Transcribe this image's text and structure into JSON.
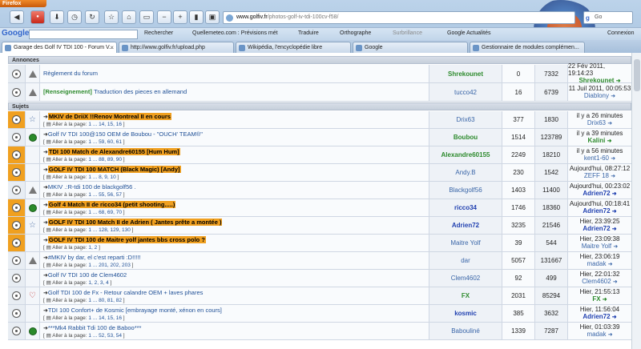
{
  "window": {
    "app_button": "Firefox"
  },
  "nav": {
    "url_host": "www.golfiv.fr",
    "url_path": "/photos-golf-iv-tdi-100cv-f58/",
    "search_placeholder": "Go"
  },
  "google_bar": {
    "logo": "Google",
    "items": [
      "Rechercher",
      "Quellemeteo.com : Prévisions mét",
      "Traduire",
      "Orthographe",
      "Surbrillance",
      "Google Actualités"
    ],
    "login": "Connexion"
  },
  "tabs": [
    {
      "label": "Garage des Golf IV TDI 100 - Forum V..."
    },
    {
      "label": "http://www.golfiv.fr/upload.php"
    },
    {
      "label": "Wikipédia, l'encyclopédie libre"
    },
    {
      "label": "Google"
    },
    {
      "label": "Gestionnaire de modules complémen..."
    }
  ],
  "sections": {
    "annonces": "Annonces",
    "sujets": "Sujets"
  },
  "announcements": [
    {
      "title": "Règlement du forum",
      "author": "Shrekounet",
      "replies": "0",
      "views": "7332",
      "last_date": "22 Fév 2011, 19:14:23",
      "last_user": "Shrekounet"
    },
    {
      "tag": "[Renseignement]",
      "title": "Traduction des pieces en allemand",
      "author": "tucco42",
      "replies": "16",
      "views": "6739",
      "last_date": "11 Juil 2011, 00:05:53",
      "last_user": "Diablony"
    }
  ],
  "topics": [
    {
      "title": "MKIV de DriiX !!Renov Montreal II en cours",
      "pages_label": "Aller à la page:",
      "pages": "1 ... 14, 15, 16",
      "author": "Drix63",
      "replies": "377",
      "views": "1830",
      "last_date": "il y a 26 minutes",
      "last_user": "Drix63"
    },
    {
      "title": "Golf IV TDI 100@150 OEM de Boubou - \"OUCH' TEAM®\"",
      "pages_label": "Aller à la page:",
      "pages": "1 ... 59, 60, 61",
      "author": "Boubou",
      "replies": "1514",
      "views": "123789",
      "last_date": "il y a 39 minutes",
      "last_user": "Kalini"
    },
    {
      "title": "TDI 100 Match de Alexandre60155 [Hum Hum]",
      "pages_label": "Aller à la page:",
      "pages": "1 ... 88, 89, 90",
      "author": "Alexandre60155",
      "replies": "2249",
      "views": "18210",
      "last_date": "il y a 56 minutes",
      "last_user": "kent1-60"
    },
    {
      "title": "GOLF IV TDI 100 MATCH (Black Magic) [Andy]",
      "pages_label": "Aller à la page:",
      "pages": "1 ... 8, 9, 10",
      "author": "Andy.B",
      "replies": "230",
      "views": "1542",
      "last_date": "Aujourd'hui, 08:27:12",
      "last_user": "ZEFF 18"
    },
    {
      "title": "MKIV .:R-tdi 100 de blackgolf56 .",
      "pages_label": "Aller à la page:",
      "pages": "1 ... 55, 56, 57",
      "author": "Blackgolf56",
      "replies": "1403",
      "views": "11400",
      "last_date": "Aujourd'hui, 00:23:02",
      "last_user": "Adrien72"
    },
    {
      "title": "Golf 4 Match II de ricco34 (petit shooting.....)",
      "pages_label": "Aller à la page:",
      "pages": "1 ... 68, 69, 70",
      "author": "ricco34",
      "replies": "1746",
      "views": "18360",
      "last_date": "Aujourd'hui, 00:18:41",
      "last_user": "Adrien72"
    },
    {
      "title": "GOLF IV TDI 100 Match II de Adrien ( Jantes prête a montée )",
      "pages_label": "Aller à la page:",
      "pages": "1 ... 128, 129, 130",
      "author": "Adrien72",
      "replies": "3235",
      "views": "21546",
      "last_date": "Hier, 23:39:25",
      "last_user": "Adrien72"
    },
    {
      "title": "GOLF IV TDI 100 de Maitre yolf jantes bbs cross polo ?",
      "pages_label": "Aller à la page:",
      "pages": "1, 2",
      "author": "Maitre Yolf",
      "replies": "39",
      "views": "544",
      "last_date": "Hier, 23:09:38",
      "last_user": "Maitre Yolf"
    },
    {
      "title": "#MKIV by dar, el c'est reparti :D!!!!!",
      "pages_label": "Aller à la page:",
      "pages": "1 ... 201, 202, 203",
      "author": "dar",
      "replies": "5057",
      "views": "131667",
      "last_date": "Hier, 23:06:19",
      "last_user": "madak"
    },
    {
      "title": "Golf IV TDI 100 de Clem4602",
      "pages_label": "Aller à la page:",
      "pages": "1, 2, 3, 4",
      "author": "Clem4602",
      "replies": "92",
      "views": "499",
      "last_date": "Hier, 22:01:32",
      "last_user": "Clem4602"
    },
    {
      "title": "Golf TDI 100 de Fx - Retour calandre OEM + laves phares",
      "pages_label": "Aller à la page:",
      "pages": "1 ... 80, 81, 82",
      "author": "FX",
      "replies": "2031",
      "views": "85294",
      "last_date": "Hier, 21:55:13",
      "last_user": "FX"
    },
    {
      "title": "TDI 100 Confort+ de Kosmic [embrayage monté, xénon en cours]",
      "pages_label": "Aller à la page:",
      "pages": "1 ... 14, 15, 16",
      "author": "kosmic",
      "replies": "385",
      "views": "3632",
      "last_date": "Hier, 11:56:04",
      "last_user": "Adrien72"
    },
    {
      "title": "***Mk4 Rabbit Tdi 100 de Baboo***",
      "pages_label": "Aller à la page:",
      "pages": "1 ... 52, 53, 54",
      "author": "Babouliné",
      "replies": "1339",
      "views": "7287",
      "last_date": "Hier, 01:03:39",
      "last_user": "madak"
    }
  ]
}
